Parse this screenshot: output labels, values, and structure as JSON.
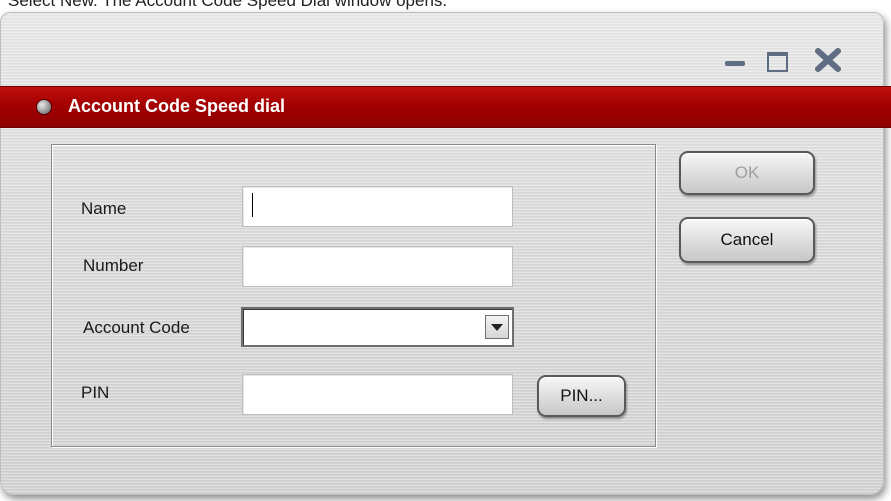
{
  "caption": "Select New. The Account Code Speed Dial window opens.",
  "window": {
    "title": "Account Code Speed dial",
    "controls": [
      "minimize-icon",
      "maximize-icon",
      "close-icon"
    ]
  },
  "form": {
    "name": {
      "label": "Name",
      "value": ""
    },
    "number": {
      "label": "Number",
      "value": ""
    },
    "account_code": {
      "label": "Account Code",
      "selected": ""
    },
    "pin": {
      "label": "PIN",
      "value": "",
      "button_label": "PIN..."
    }
  },
  "buttons": {
    "ok_label": "OK",
    "cancel_label": "Cancel"
  },
  "colors": {
    "title_bar": "#a30000",
    "window_bg": "#d9d9d9",
    "disabled_text": "#a0a0a0"
  }
}
